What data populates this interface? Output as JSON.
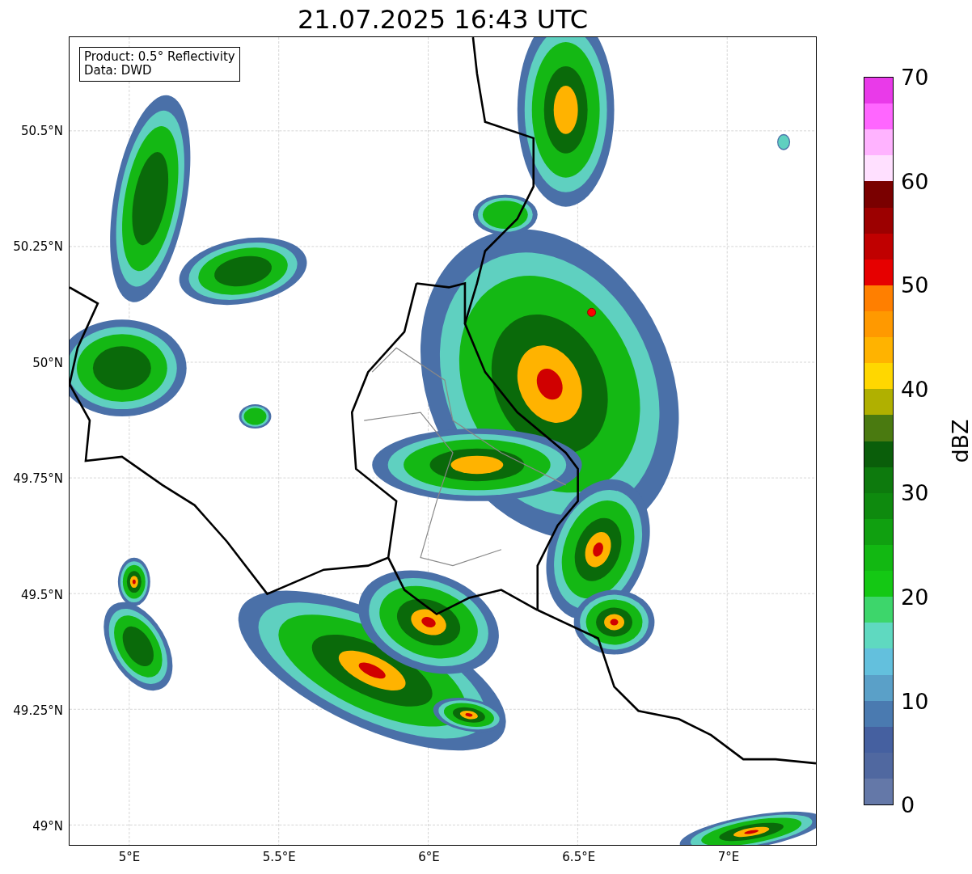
{
  "title": "21.07.2025 16:43 UTC",
  "map": {
    "legend": [
      "Product: 0.5° Reflectivity",
      "Data: DWD"
    ],
    "lat_labels": [
      "50.5°N",
      "50.25°N",
      "50°N",
      "49.75°N",
      "49.5°N",
      "49.25°N",
      "49°N"
    ],
    "lon_labels": [
      "5°E",
      "5.5°E",
      "6°E",
      "6.5°E",
      "7°E"
    ]
  },
  "colorbar": {
    "label": "dBZ",
    "ticks": [
      "70",
      "60",
      "50",
      "40",
      "30",
      "20",
      "10",
      "0"
    ],
    "steps": [
      {
        "color": "#e93ae9"
      },
      {
        "color": "#ff66ff"
      },
      {
        "color": "#ffb3ff"
      },
      {
        "color": "#ffe0ff"
      },
      {
        "color": "#7a0000"
      },
      {
        "color": "#9c0000"
      },
      {
        "color": "#c00000"
      },
      {
        "color": "#e60000"
      },
      {
        "color": "#ff7f00"
      },
      {
        "color": "#ff9900"
      },
      {
        "color": "#ffb300"
      },
      {
        "color": "#ffd700"
      },
      {
        "color": "#b0b000"
      },
      {
        "color": "#4a7a10"
      },
      {
        "color": "#0a5e0a"
      },
      {
        "color": "#0d7a0d"
      },
      {
        "color": "#0e8a0e"
      },
      {
        "color": "#10a010"
      },
      {
        "color": "#12b812"
      },
      {
        "color": "#14c814"
      },
      {
        "color": "#3dd66b"
      },
      {
        "color": "#5fd9c0"
      },
      {
        "color": "#63c0dd"
      },
      {
        "color": "#5aa0c8"
      },
      {
        "color": "#4a7ab0"
      },
      {
        "color": "#4560a0"
      },
      {
        "color": "#5068a0"
      },
      {
        "color": "#6478a8"
      }
    ]
  }
}
